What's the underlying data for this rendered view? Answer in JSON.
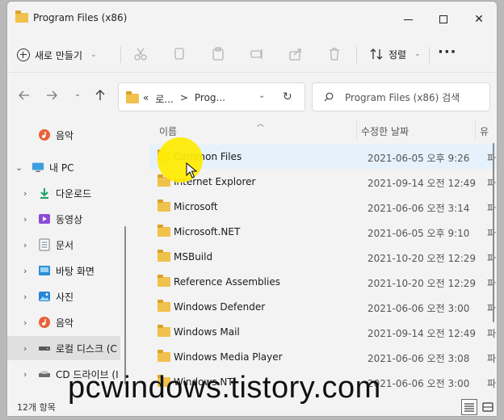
{
  "window": {
    "title": "Program Files (x86)"
  },
  "toolbar": {
    "new_label": "새로 만들기",
    "sort_label": "정렬",
    "more_label": "···"
  },
  "address": {
    "prefix": "«",
    "crumb1": "로...",
    "separator": ">",
    "crumb2": "Prog..."
  },
  "search": {
    "placeholder": "Program Files (x86) 검색"
  },
  "sidebar": {
    "items": [
      {
        "label": "음악",
        "icon": "music-icon"
      },
      {
        "label": "내 PC",
        "icon": "pc-icon"
      },
      {
        "label": "다운로드",
        "icon": "download-icon"
      },
      {
        "label": "동영상",
        "icon": "video-icon"
      },
      {
        "label": "문서",
        "icon": "document-icon"
      },
      {
        "label": "바탕 화면",
        "icon": "desktop-icon"
      },
      {
        "label": "사진",
        "icon": "photo-icon"
      },
      {
        "label": "음악",
        "icon": "music-icon"
      },
      {
        "label": "로컬 디스크 (C",
        "icon": "disk-icon"
      },
      {
        "label": "CD 드라이브 (I",
        "icon": "cd-drive-icon"
      }
    ]
  },
  "columns": {
    "name": "이름",
    "date": "수정한 날짜",
    "type": "유"
  },
  "files": [
    {
      "name": "Common Files",
      "date": "2021-06-05 오후 9:26",
      "type": "파"
    },
    {
      "name": "Internet Explorer",
      "date": "2021-09-14 오전 12:49",
      "type": "파"
    },
    {
      "name": "Microsoft",
      "date": "2021-06-06 오전 3:14",
      "type": "파"
    },
    {
      "name": "Microsoft.NET",
      "date": "2021-06-05 오후 9:10",
      "type": "파"
    },
    {
      "name": "MSBuild",
      "date": "2021-10-20 오전 12:29",
      "type": "파"
    },
    {
      "name": "Reference Assemblies",
      "date": "2021-10-20 오전 12:29",
      "type": "파"
    },
    {
      "name": "Windows Defender",
      "date": "2021-06-06 오전 3:00",
      "type": "파"
    },
    {
      "name": "Windows Mail",
      "date": "2021-09-14 오전 12:49",
      "type": "파"
    },
    {
      "name": "Windows Media Player",
      "date": "2021-06-06 오전 3:08",
      "type": "파"
    },
    {
      "name": "Windows NT",
      "date": "2021-06-06 오전 3:00",
      "type": "파"
    }
  ],
  "status": {
    "count": "12개 항목"
  },
  "watermark": {
    "text": "pcwindows.tistory.com"
  }
}
